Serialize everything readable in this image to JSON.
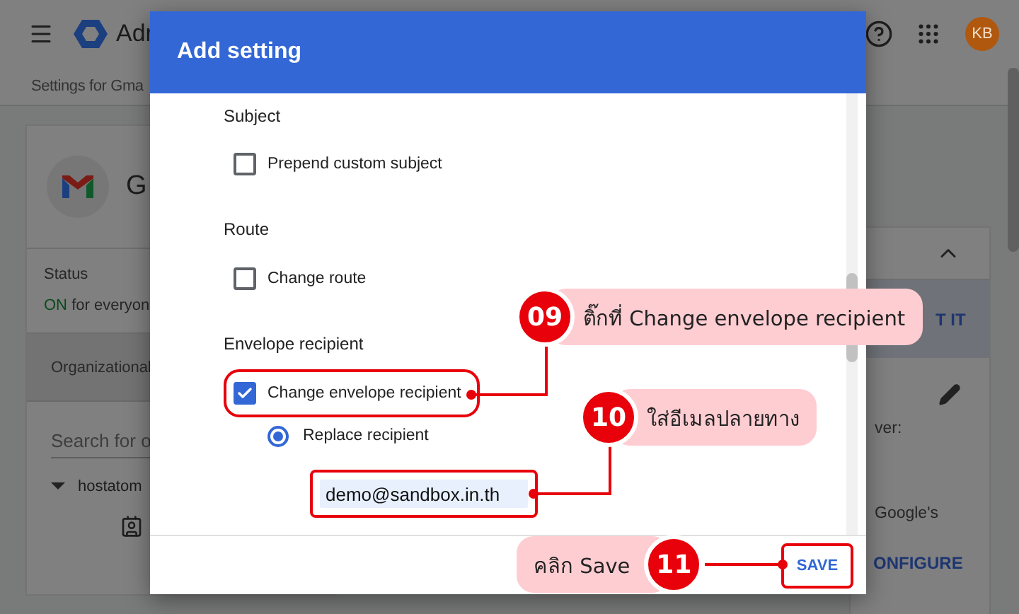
{
  "topbar": {
    "product": "Adr",
    "avatar": "KB"
  },
  "breadcrumb": "Settings for Gma",
  "left_card": {
    "title": "G",
    "status_label": "Status",
    "status_value": "ON",
    "status_scope": "for everyon",
    "org_tab": "Organizational",
    "search": {
      "placeholder": "Search for o"
    },
    "tree": [
      {
        "label": "hostatom",
        "expanded": true
      }
    ]
  },
  "right_card": {
    "button": "T IT",
    "text_1": "ver:",
    "text_2": "Google's",
    "link": "ONFIGURE"
  },
  "dialog": {
    "title": "Add setting",
    "sections": [
      {
        "heading": "Subject",
        "options": [
          {
            "kind": "checkbox",
            "label": "Prepend custom subject",
            "checked": false,
            "highlighted": false
          }
        ]
      },
      {
        "heading": "Route",
        "options": [
          {
            "kind": "checkbox",
            "label": "Change route",
            "checked": false,
            "highlighted": false
          }
        ]
      },
      {
        "heading": "Envelope recipient",
        "options": [
          {
            "kind": "checkbox",
            "label": "Change envelope recipient",
            "checked": true,
            "highlighted": true
          },
          {
            "kind": "radio",
            "label": "Replace recipient",
            "selected": true,
            "highlighted": false
          },
          {
            "kind": "input",
            "value": "demo@sandbox.in.th",
            "highlighted": true
          }
        ]
      }
    ],
    "save": {
      "label": "SAVE",
      "highlighted": true
    }
  },
  "annotations": [
    {
      "step": "09",
      "text": "ติ๊กที่ Change envelope recipient",
      "kind": "trailing"
    },
    {
      "step": "10",
      "text": "ใส่อีเมลปลายทาง",
      "kind": "trailing"
    },
    {
      "step": "11",
      "text": "คลิก Save",
      "kind": "leading"
    }
  ]
}
